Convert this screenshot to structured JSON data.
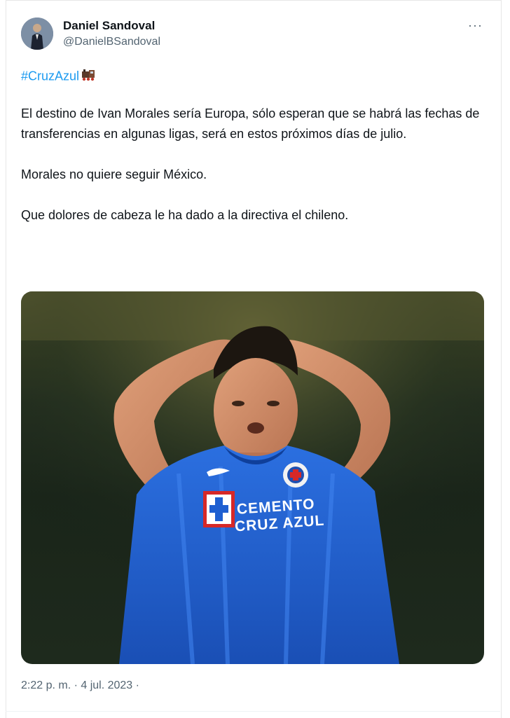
{
  "author": {
    "display_name": "Daniel Sandoval",
    "handle": "@DanielBSandoval",
    "avatar_icon": "avatar-photo"
  },
  "more_icon": "more-options-icon",
  "more_glyph": "···",
  "tweet": {
    "hashtag": "#CruzAzul",
    "hashtag_emoji": "train-emoji",
    "paragraphs": [
      "El destino de Ivan Morales sería Europa, sólo esperan que se habrá las fechas de transferencias en algunas ligas, será en estos próximos días de julio.",
      "Morales no quiere seguir México.",
      "Que dolores de cabeza le ha dado a la directiva el chileno."
    ],
    "image": {
      "jersey_text_line1": "CEMENTO",
      "jersey_text_line2": "CRUZ AZUL"
    },
    "timestamp": "2:22 p. m. · 4 jul. 2023 ·"
  },
  "colors": {
    "link": "#1d9bf0",
    "secondary_text": "#536471",
    "primary_text": "#0f1419",
    "jersey_blue": "#1f5fd1"
  }
}
